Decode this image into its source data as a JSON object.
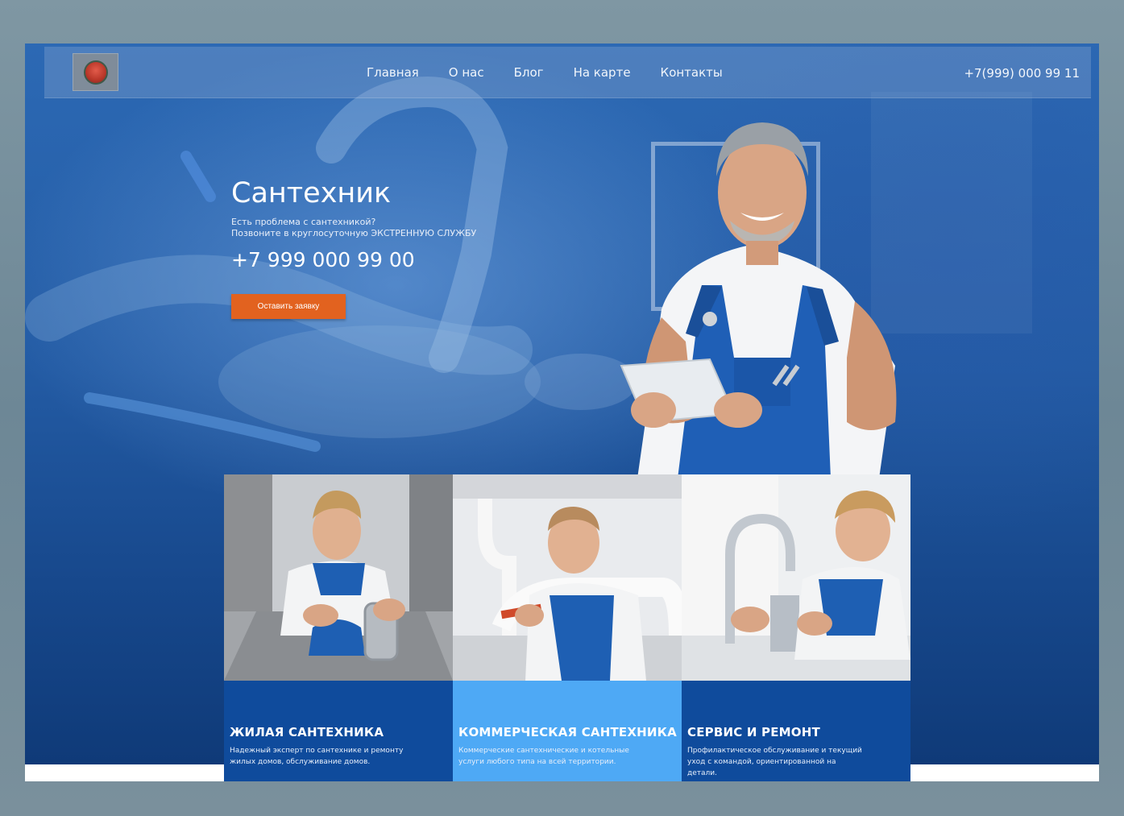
{
  "nav": {
    "items": [
      "Главная",
      "О нас",
      "Блог",
      "На карте",
      "Контакты"
    ],
    "phone": "+7(999) 000 99 11"
  },
  "hero": {
    "title": "Сантехник",
    "subtitle_line1": "Есть проблема с сантехникой?",
    "subtitle_line2": "Позвоните в круглосуточную ЭКСТРЕННУЮ СЛУЖБУ",
    "phone": "+7 999 000 99 00",
    "cta_label": "Оставить заявку"
  },
  "cards": [
    {
      "title": "ЖИЛАЯ САНТЕХНИКА",
      "text": "Надежный эксперт по сантехнике и ремонту жилых домов, обслуживание домов."
    },
    {
      "title": "КОММЕРЧЕСКАЯ САНТЕХНИКА",
      "text": "Коммерческие сантехнические и котельные услуги любого типа на всей территории."
    },
    {
      "title": "СЕРВИС И РЕМОНТ",
      "text": "Профилактическое обслуживание и текущий уход с командой, ориентированной на детали."
    }
  ],
  "colors": {
    "hero_blue": "#235ba4",
    "cta_orange": "#e2621f",
    "card_dark": "#0e4a9a",
    "card_light": "#4da8f4"
  }
}
